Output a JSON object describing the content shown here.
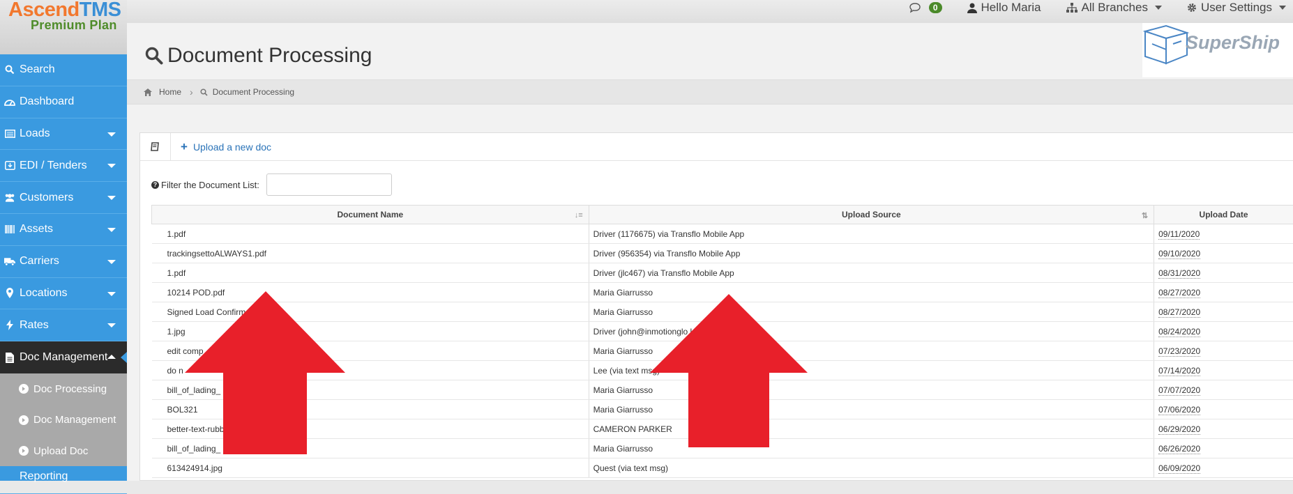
{
  "brand": {
    "name_part1": "Ascend",
    "name_part2": "TMS",
    "plan": "Premium Plan"
  },
  "topnav": {
    "messages_count": "0",
    "greeting": "Hello Maria",
    "branches": "All Branches",
    "user_settings": "User Settings"
  },
  "sidebar": {
    "items": [
      {
        "label": "Search",
        "icon": "search-icon"
      },
      {
        "label": "Dashboard",
        "icon": "dashboard-icon"
      },
      {
        "label": "Loads",
        "icon": "list-icon"
      },
      {
        "label": "EDI / Tenders",
        "icon": "exchange-icon"
      },
      {
        "label": "Customers",
        "icon": "users-icon"
      },
      {
        "label": "Assets",
        "icon": "barcode-icon"
      },
      {
        "label": "Carriers",
        "icon": "truck-icon"
      },
      {
        "label": "Locations",
        "icon": "map-marker-icon"
      },
      {
        "label": "Rates",
        "icon": "bolt-icon"
      },
      {
        "label": "Doc Management",
        "icon": "file-icon"
      }
    ],
    "subitems": [
      {
        "label": "Doc Processing"
      },
      {
        "label": "Doc Management"
      },
      {
        "label": "Upload Doc"
      }
    ],
    "more_label": "Reporting"
  },
  "page": {
    "title": "Document Processing",
    "logo_text": "SuperShip",
    "breadcrumb": {
      "home": "Home",
      "current": "Document Processing"
    }
  },
  "toolbar": {
    "upload_label": "Upload a new doc"
  },
  "filter": {
    "label": "Filter the Document List:",
    "value": ""
  },
  "table": {
    "headers": [
      "Document Name",
      "Upload Source",
      "Upload Date"
    ],
    "rows": [
      [
        "1.pdf",
        "Driver (1176675) via Transflo Mobile App",
        "09/11/2020"
      ],
      [
        "trackingsettoALWAYS1.pdf",
        "Driver (956354) via Transflo Mobile App",
        "09/10/2020"
      ],
      [
        "1.pdf",
        "Driver (jlc467) via Transflo Mobile App",
        "08/31/2020"
      ],
      [
        "10214 POD.pdf",
        "Maria Giarrusso",
        "08/27/2020"
      ],
      [
        "Signed Load Confirm",
        "Maria Giarrusso",
        "08/27/2020"
      ],
      [
        "1.jpg",
        "Driver (john@inmotionglo                         lo Mobile App",
        "08/24/2020"
      ],
      [
        "edit comp",
        "Maria Giarrusso",
        "07/23/2020"
      ],
      [
        "do n",
        "Lee (via text msg)",
        "07/14/2020"
      ],
      [
        "bill_of_lading_                           329.pdf",
        "Maria Giarrusso",
        "07/07/2020"
      ],
      [
        "BOL321",
        "Maria Giarrusso",
        "07/06/2020"
      ],
      [
        "better-text-rubb                            7004.jpg",
        "CAMERON PARKER",
        "06/29/2020"
      ],
      [
        "bill_of_lading_                           329.pdf",
        "Maria Giarrusso",
        "06/26/2020"
      ],
      [
        "613424914.jpg",
        "Quest (via text msg)",
        "06/09/2020"
      ]
    ]
  },
  "colors": {
    "sidebar": "#3a9ae0",
    "sidebar_active": "#2b2b2b",
    "submenu": "#a9a9a9",
    "accent_link": "#2a73b8",
    "arrow": "#e8202a"
  }
}
